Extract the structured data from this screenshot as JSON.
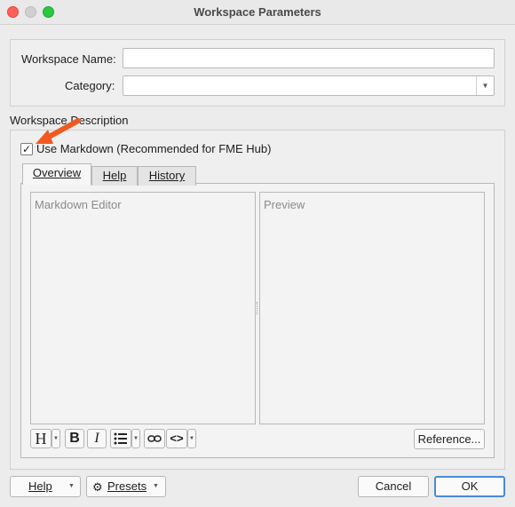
{
  "window": {
    "title": "Workspace Parameters"
  },
  "params": {
    "name_label": "Workspace Name:",
    "name_value": "",
    "category_label": "Category:",
    "category_value": ""
  },
  "description": {
    "section_label": "Workspace Description",
    "use_markdown_label": "Use Markdown (Recommended for FME Hub)",
    "use_markdown_checked": true,
    "tabs": [
      {
        "label": "Overview",
        "active": true
      },
      {
        "label": "Help",
        "active": false
      },
      {
        "label": "History",
        "active": false
      }
    ],
    "editor_placeholder": "Markdown Editor",
    "preview_placeholder": "Preview",
    "reference_button": "Reference..."
  },
  "footer": {
    "help_label": "Help",
    "presets_label": "Presets",
    "cancel_label": "Cancel",
    "ok_label": "OK"
  },
  "colors": {
    "annotation_arrow": "#f05a22",
    "ok_focus": "#4b8ad8"
  }
}
